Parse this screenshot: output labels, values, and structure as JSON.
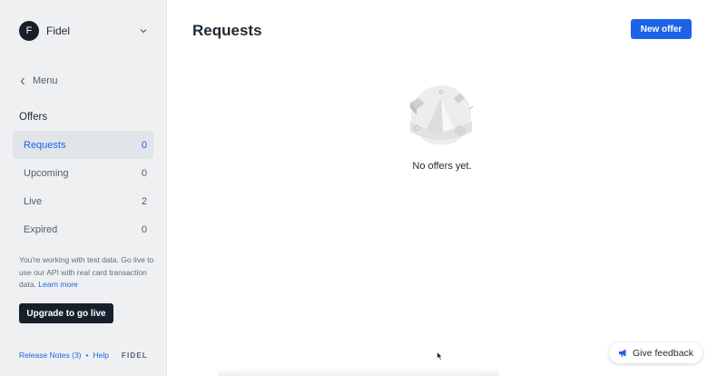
{
  "account": {
    "initial": "F",
    "name": "Fidel"
  },
  "sidebar": {
    "menu_label": "Menu",
    "section_title": "Offers",
    "items": [
      {
        "label": "Requests",
        "count": "0",
        "active": true
      },
      {
        "label": "Upcoming",
        "count": "0",
        "active": false
      },
      {
        "label": "Live",
        "count": "2",
        "active": false
      },
      {
        "label": "Expired",
        "count": "0",
        "active": false
      }
    ],
    "note_text": "You're working with test data. Go live to use our API with real card transaction data.",
    "note_link": "Learn more",
    "upgrade_label": "Upgrade to go live",
    "footer": {
      "release_notes": "Release Notes (3)",
      "separator": "•",
      "help": "Help",
      "brand": "FIDEL"
    }
  },
  "main": {
    "title": "Requests",
    "new_offer_label": "New offer",
    "empty_text": "No offers yet."
  },
  "feedback": {
    "label": "Give feedback"
  },
  "colors": {
    "accent": "#1d63e8",
    "dark": "#17202a",
    "sidebar_bg": "#eef0f2"
  }
}
